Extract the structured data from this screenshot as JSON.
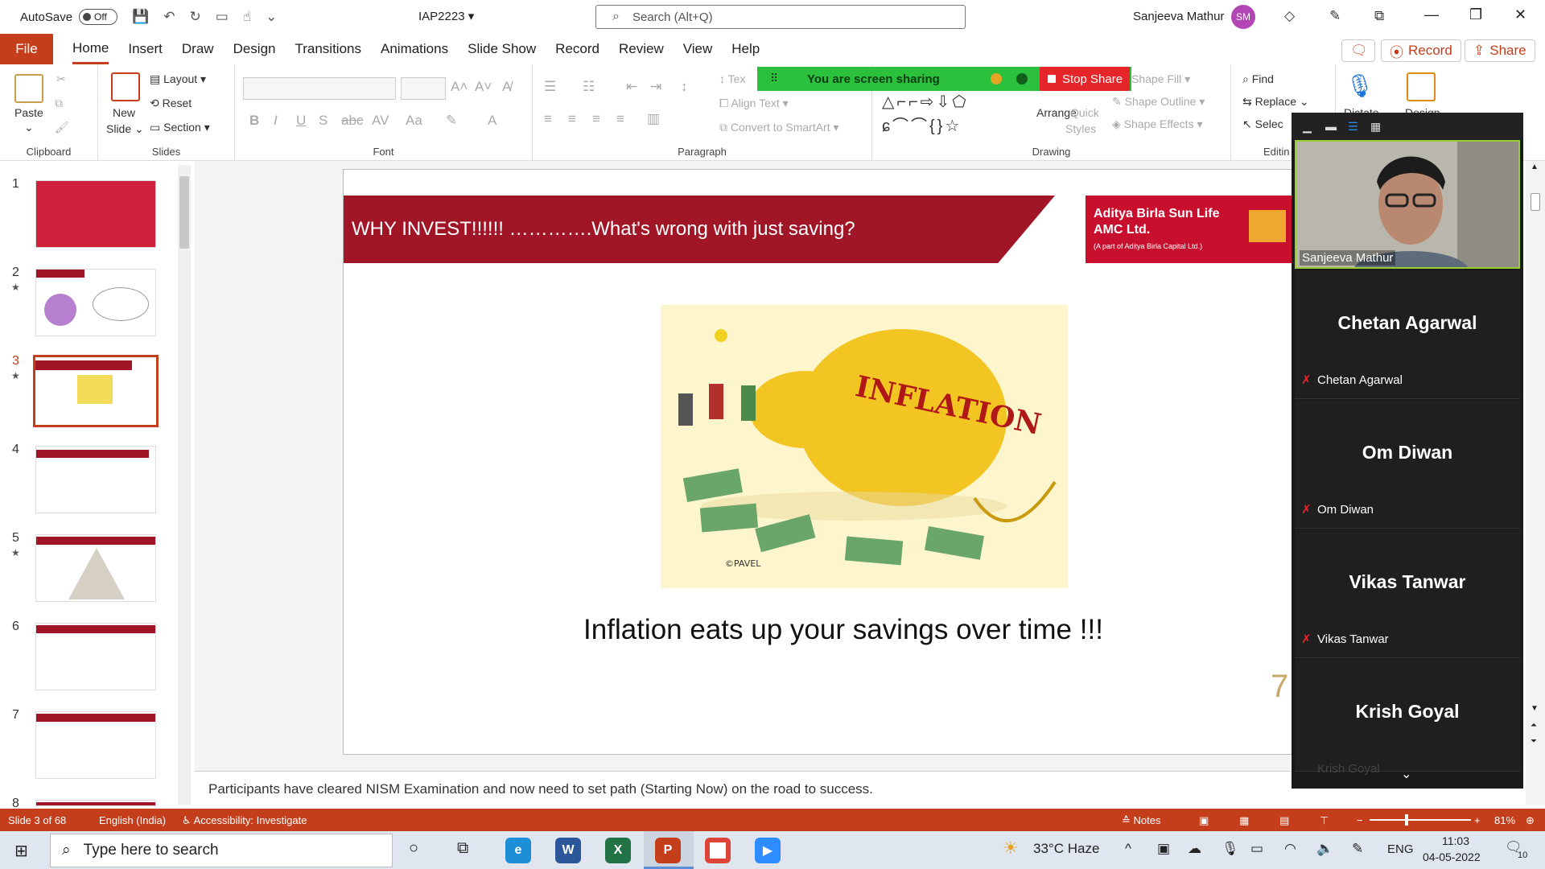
{
  "titlebar": {
    "autosave_label": "AutoSave",
    "autosave_state": "Off",
    "doc_title": "IAP2223",
    "search_placeholder": "Search (Alt+Q)",
    "user_name": "Sanjeeva Mathur",
    "user_initials": "SM"
  },
  "tabs": [
    "File",
    "Home",
    "Insert",
    "Draw",
    "Design",
    "Transitions",
    "Animations",
    "Slide Show",
    "Record",
    "Review",
    "View",
    "Help"
  ],
  "active_tab": "Home",
  "tab_actions": {
    "record": "Record",
    "share": "Share"
  },
  "ribbon": {
    "clipboard": {
      "paste": "Paste",
      "label": "Clipboard"
    },
    "slides": {
      "new_slide": "New",
      "new_slide2": "Slide",
      "layout": "Layout",
      "reset": "Reset",
      "section": "Section",
      "label": "Slides"
    },
    "font": {
      "label": "Font"
    },
    "paragraph": {
      "label": "Paragraph",
      "text_direction": "Tex",
      "align_text": "Align Text",
      "convert_smartart": "Convert to SmartArt"
    },
    "drawing": {
      "label": "Drawing",
      "arrange": "Arrange",
      "quick_styles": "Quick",
      "quick_styles2": "Styles",
      "shape_fill": "Shape Fill",
      "shape_outline": "Shape Outline",
      "shape_effects": "Shape Effects"
    },
    "editing": {
      "label": "Editin",
      "find": "Find",
      "replace": "Replace",
      "select": "Selec"
    },
    "dictate": "Dictate",
    "designer": "Design"
  },
  "sharebar": {
    "text": "You are screen sharing",
    "stop": "Stop Share"
  },
  "thumbnails": [
    {
      "num": "1",
      "star": false
    },
    {
      "num": "2",
      "star": true
    },
    {
      "num": "3",
      "star": true,
      "selected": true
    },
    {
      "num": "4",
      "star": false
    },
    {
      "num": "5",
      "star": true
    },
    {
      "num": "6",
      "star": false
    },
    {
      "num": "7",
      "star": false
    },
    {
      "num": "8",
      "star": false
    }
  ],
  "slide": {
    "banner": "WHY INVEST!!!!!! ………….What's wrong with just saving?",
    "logo_line1": "Aditya Birla Sun Life",
    "logo_line2": "AMC Ltd.",
    "logo_line3": "(A part of Aditya Birla Capital Ltd.)",
    "cartoon_word": "INFLATION",
    "cartoon_sign": "©PAVEL",
    "caption": "Inflation eats up your savings over time !!!",
    "corner_digit": "7"
  },
  "notes": "Participants have cleared NISM Examination and now need to set path (Starting Now) on the road to success.",
  "zoom": {
    "host_video_name": "Sanjeeva Mathur",
    "participants": [
      {
        "big": "Chetan Agarwal",
        "small": "Chetan Agarwal"
      },
      {
        "big": "Om Diwan",
        "small": "Om Diwan"
      },
      {
        "big": "Vikas Tanwar",
        "small": "Vikas Tanwar"
      },
      {
        "big": "Krish Goyal",
        "small": "Krish Goyal"
      }
    ]
  },
  "statusbar": {
    "slide_info": "Slide 3 of 68",
    "language": "English (India)",
    "accessibility": "Accessibility: Investigate",
    "notes": "Notes",
    "zoom": "81%"
  },
  "taskbar": {
    "search_placeholder": "Type here to search",
    "weather": "33°C  Haze",
    "lang": "ENG",
    "time": "11:03",
    "date": "04-05-2022",
    "notif_count": "10"
  },
  "colors": {
    "accent": "#c43e1c",
    "banner": "#a01627",
    "share_green": "#2cc13d",
    "stop_red": "#e5252a"
  }
}
